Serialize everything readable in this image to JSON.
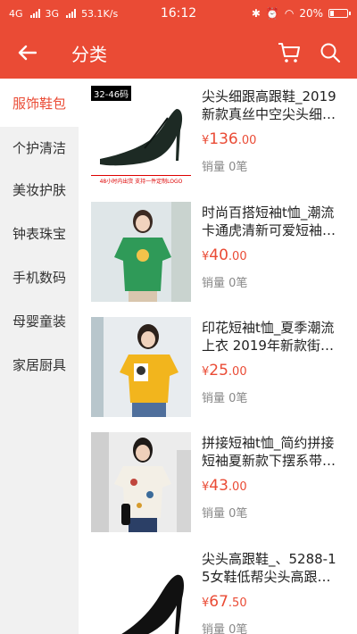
{
  "status": {
    "network_left": "4G",
    "network_right": "3G",
    "speed": "53.1K/s",
    "time": "16:12",
    "battery": "20%",
    "battery_level": 0.2
  },
  "header": {
    "title": "分类",
    "back_icon": "arrow-left-icon",
    "cart_icon": "cart-icon",
    "search_icon": "search-icon"
  },
  "sidebar": {
    "items": [
      {
        "label": "服饰鞋包",
        "active": true
      },
      {
        "label": "个护清洁",
        "active": false
      },
      {
        "label": "美妆护肤",
        "active": false
      },
      {
        "label": "钟表珠宝",
        "active": false
      },
      {
        "label": "手机数码",
        "active": false
      },
      {
        "label": "母婴童装",
        "active": false
      },
      {
        "label": "家居厨具",
        "active": false
      }
    ]
  },
  "products": [
    {
      "name": "尖头细跟高跟鞋_2019新款真丝中空尖头细…",
      "currency": "¥",
      "price_int": "136",
      "price_dec": ".00",
      "sales": "销量 0笔",
      "thumb_label": "32-46码",
      "thumb_banner": "48小时内出货 支持一件定制LOGO"
    },
    {
      "name": "时尚百搭短袖t恤_潮流卡通虎清新可爱短袖…",
      "currency": "¥",
      "price_int": "40",
      "price_dec": ".00",
      "sales": "销量 0笔"
    },
    {
      "name": "印花短袖t恤_夏季潮流上衣 2019年新款街…",
      "currency": "¥",
      "price_int": "25",
      "price_dec": ".00",
      "sales": "销量 0笔"
    },
    {
      "name": "拼接短袖t恤_简约拼接短袖夏新款下摆系带…",
      "currency": "¥",
      "price_int": "43",
      "price_dec": ".00",
      "sales": "销量 0笔"
    },
    {
      "name": "尖头高跟鞋_、5288-15女鞋低帮尖头高跟…",
      "currency": "¥",
      "price_int": "67",
      "price_dec": ".50",
      "sales": "销量 0笔"
    }
  ],
  "colors": {
    "accent": "#ea4b35",
    "sidebar_bg": "#f1f1f1"
  }
}
